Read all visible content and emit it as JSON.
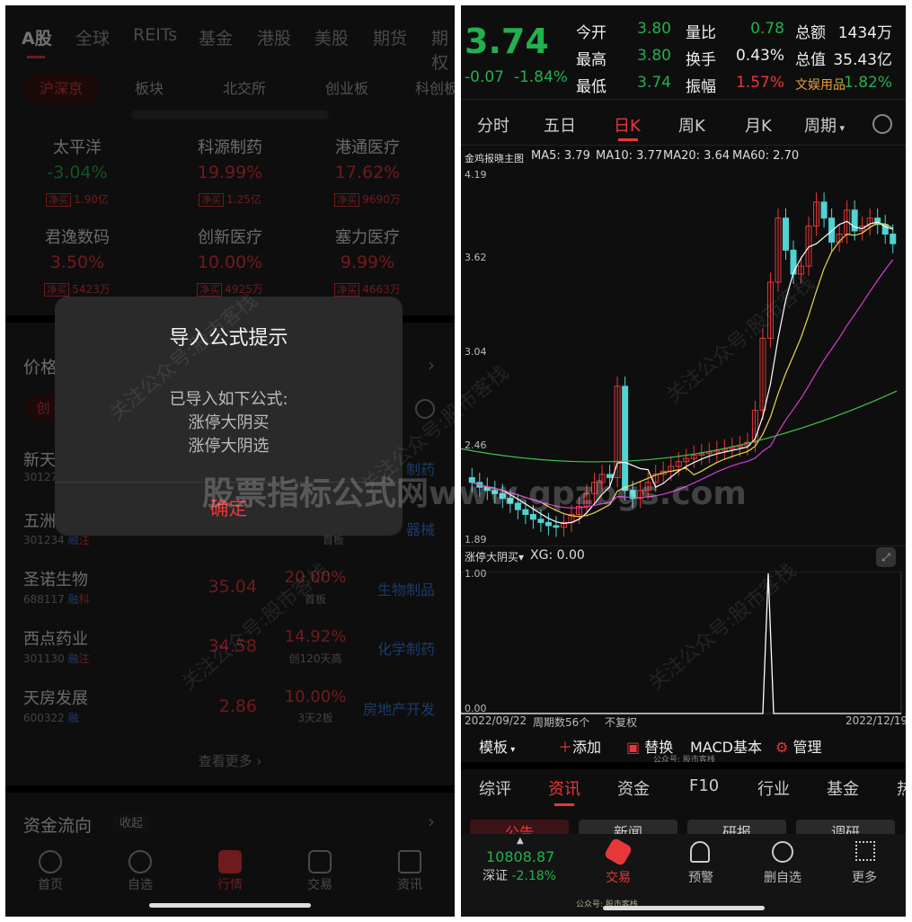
{
  "left": {
    "tabs": [
      "A股",
      "全球",
      "REITs",
      "基金",
      "港股",
      "美股",
      "期货",
      "期权"
    ],
    "chips": [
      "沪深京",
      "板块",
      "北交所",
      "创业板",
      "科创板"
    ],
    "sectors": [
      {
        "name": "太平洋",
        "pct": "-3.04%",
        "tag": "净买",
        "amount": "1.90亿"
      },
      {
        "name": "科源制药",
        "pct": "19.99%",
        "tag": "净买",
        "amount": "1.25亿"
      },
      {
        "name": "港通医疗",
        "pct": "17.62%",
        "tag": "净买",
        "amount": "9690万"
      },
      {
        "name": "君逸数码",
        "pct": "3.50%",
        "tag": "净买",
        "amount": "5423万"
      },
      {
        "name": "创新医疗",
        "pct": "10.00%",
        "tag": "净买",
        "amount": "4925万"
      },
      {
        "name": "塞力医疗",
        "pct": "9.99%",
        "tag": "净买",
        "amount": "4663万"
      }
    ],
    "section_title": "价格",
    "filter_chip": "创",
    "rows": [
      {
        "name": "新天",
        "code": "30127",
        "price": "",
        "pct": "",
        "note": "",
        "industry": "制药"
      },
      {
        "name": "五洲",
        "code": "301234",
        "flags": [
          "融",
          "注"
        ],
        "price": "",
        "pct": "",
        "note": "首板",
        "industry": "器械"
      },
      {
        "name": "圣诺生物",
        "code": "688117",
        "flags": [
          "融",
          "科"
        ],
        "price": "35.04",
        "pct": "20.00%",
        "note": "首板",
        "industry": "生物制品"
      },
      {
        "name": "西点药业",
        "code": "301130",
        "flags": [
          "融",
          "注"
        ],
        "price": "34.58",
        "pct": "14.92%",
        "note": "创120天高",
        "industry": "化学制药"
      },
      {
        "name": "天房发展",
        "code": "600322",
        "flags": [
          "融"
        ],
        "price": "2.86",
        "pct": "10.00%",
        "note": "3天2板",
        "industry": "房地产开发"
      }
    ],
    "see_more": "查看更多",
    "fund_title": "资金流向",
    "fund_toggle": "收起",
    "nav": [
      "首页",
      "自选",
      "行情",
      "交易",
      "资讯"
    ],
    "modal": {
      "title": "导入公式提示",
      "line1": "已导入如下公式:",
      "line2": "涨停大阴买",
      "line3": "涨停大阴选",
      "confirm": "确定"
    }
  },
  "right": {
    "price": "3.74",
    "change": "-0.07",
    "change_pct": "-1.84%",
    "stats": [
      {
        "label": "今开",
        "value": "3.80",
        "color": "#23b04f"
      },
      {
        "label": "量比",
        "value": "0.78",
        "color": "#23b04f"
      },
      {
        "label": "总额",
        "value": "1434万",
        "color": "#eeeeee"
      },
      {
        "label": "最高",
        "value": "3.80",
        "color": "#23b04f"
      },
      {
        "label": "换手",
        "value": "0.43%",
        "color": "#eeeeee"
      },
      {
        "label": "总值",
        "value": "35.43亿",
        "color": "#eeeeee"
      },
      {
        "label": "最低",
        "value": "3.74",
        "color": "#23b04f"
      },
      {
        "label": "振幅",
        "value": "1.57%",
        "color": "#e8373b"
      },
      {
        "label": "文娱用品",
        "value": "-1.82%",
        "color": "#23b04f"
      }
    ],
    "ktabs": [
      "分时",
      "五日",
      "日K",
      "周K",
      "月K",
      "周期"
    ],
    "main_indicator": "金鸡报晓主图",
    "ma": [
      {
        "label": "MA5: 3.79",
        "color": "#ffffff"
      },
      {
        "label": "MA10: 3.77",
        "color": "#e6d94a"
      },
      {
        "label": "MA20: 3.64",
        "color": "#d63bd6"
      },
      {
        "label": "MA60: 2.70",
        "color": "#41c34a"
      }
    ],
    "price_axis": [
      "4.19",
      "3.62",
      "3.04",
      "2.46",
      "1.89"
    ],
    "sub_indicator": "涨停大阴买",
    "xg": "XG: 0.00",
    "sub_axis": [
      "1.00",
      "0.00"
    ],
    "date_start": "2022/09/22",
    "period_count": "周期数56个",
    "adjust": "不复权",
    "date_end": "2022/12/19",
    "tools": [
      "模板",
      "添加",
      "替换",
      "MACD基本",
      "管理"
    ],
    "btabs": [
      "综评",
      "资讯",
      "资金",
      "F10",
      "行业",
      "基金",
      "热"
    ],
    "subtabs": [
      "公告",
      "新闻",
      "研报",
      "调研"
    ],
    "index_value": "10808.87",
    "index_name": "深证",
    "index_pct": "-2.18%",
    "nav": [
      "交易",
      "预警",
      "删自选",
      "更多"
    ],
    "watermark_small": "公众号: 股市客栈",
    "watermark_big": "股票指标公式网www.gpzbgs.com",
    "watermark_diag": "关注公众号:股市客栈"
  }
}
